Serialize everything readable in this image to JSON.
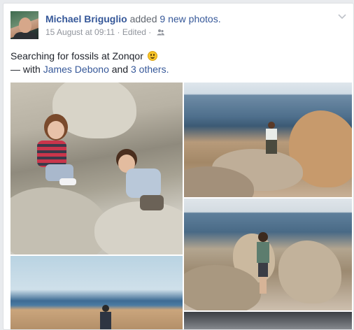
{
  "post": {
    "author": "Michael Briguglio",
    "verb": "added",
    "photos_link": "9 new photos.",
    "timestamp": "15 August at 09:11",
    "edited": "Edited",
    "audience_icon": "friends-icon",
    "options_icon": "chevron-down-icon",
    "status_text": "Searching for fossils at Zonqor",
    "emoji": "smile-emoji",
    "with_prefix": "— with",
    "tagged_person": "James Debono",
    "and_text": "and",
    "others_link": "3 others."
  },
  "photos": [
    {
      "id": "photo-1",
      "subject": "two children climbing on rocks"
    },
    {
      "id": "photo-2",
      "subject": "child on rocks by the sea"
    },
    {
      "id": "photo-3",
      "subject": "boy standing between rocks by the sea"
    },
    {
      "id": "photo-4",
      "subject": "man on rocky shore"
    },
    {
      "id": "photo-5",
      "subject": "partially visible photo"
    }
  ],
  "colors": {
    "link": "#365899",
    "text": "#1d2129",
    "meta": "#90949c",
    "background": "#e9ebee"
  }
}
